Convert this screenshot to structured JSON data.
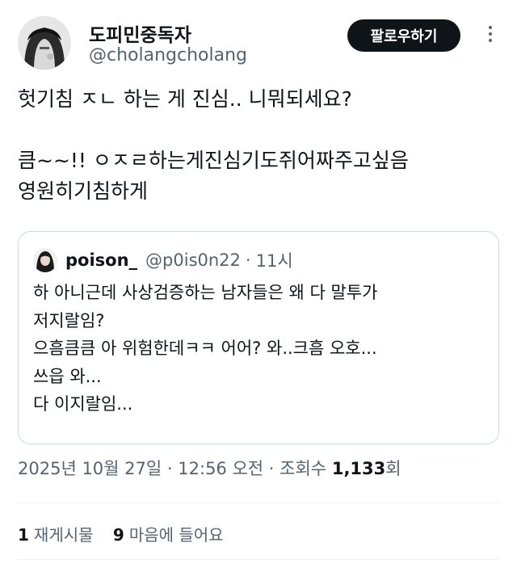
{
  "author": {
    "display_name": "도피민중독자",
    "handle": "@cholangcholang",
    "avatar_icon": "grayscale-character-avatar"
  },
  "follow_button_label": "팔로우하기",
  "more_icon": "more-vertical-icon",
  "tweet_text": "헛기침 ㅈㄴ 하는 게 진심.. 니뭐되세요?\n\n큼~~!! ㅇㅈㄹ하는게진심기도쥐어짜주고싶음\n영원히기침하게",
  "quote": {
    "display_name": "poison_",
    "handle": "@p0is0n22",
    "separator": "·",
    "time": "11시",
    "text": "하 아니근데 사상검증하는 남자들은 왜 다 말투가\n저지랄임?\n으흠큼큼 아 위험한데ㅋㅋ 어어? 와..크흠 오호...\n쓰읍 와...\n다 이지랄임..."
  },
  "meta": {
    "date": "2025년 10월 27일",
    "separator": "·",
    "time": "12:56 오전",
    "views_label": "조회수",
    "views_count": "1,133",
    "views_suffix": "회"
  },
  "stats": {
    "reposts_count": "1",
    "reposts_label": "재게시물",
    "likes_count": "9",
    "likes_label": "마음에 들어요"
  },
  "colors": {
    "text": "#0f1419",
    "secondary": "#536471",
    "border": "#cfd9de",
    "button_bg": "#0f1419"
  }
}
